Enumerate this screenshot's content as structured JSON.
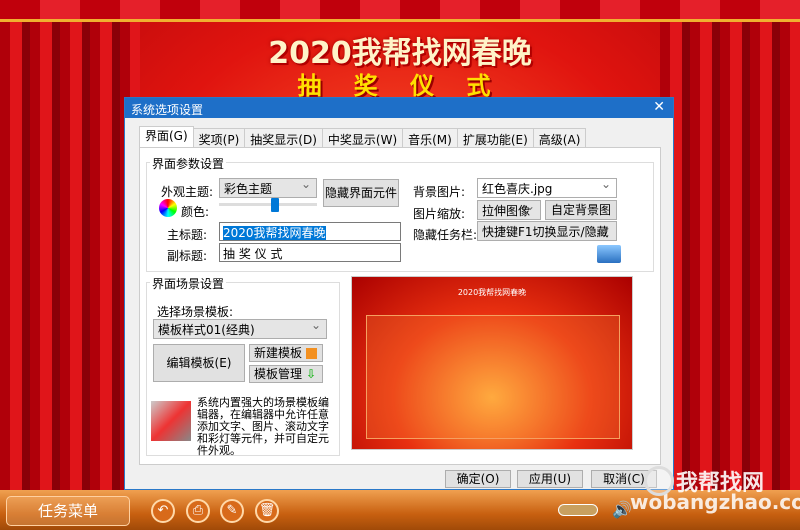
{
  "stage": {
    "title": "2020我帮找网春晚",
    "subtitle": "抽 奖 仪 式"
  },
  "dialog": {
    "title": "系统选项设置",
    "tabs": [
      "界面(G)",
      "奖项(P)",
      "抽奖显示(D)",
      "中奖显示(W)",
      "音乐(M)",
      "扩展功能(E)",
      "高级(A)"
    ],
    "params": {
      "group_label": "界面参数设置",
      "theme_label": "外观主题:",
      "theme_value": "彩色主题",
      "hide_ui_button": "隐藏界面元件",
      "color_label": "颜色:",
      "color_slider_position": 0.55,
      "main_title_label": "主标题:",
      "main_title_value": "2020我帮找网春晚",
      "subtitle_label": "副标题:",
      "subtitle_value": "抽 奖 仪 式",
      "bg_label": "背景图片:",
      "bg_value": "红色喜庆.jpg",
      "scale_label": "图片缩放:",
      "scale_value": "拉伸图像",
      "custom_bg_button": "自定背景图片",
      "taskbar_label": "隐藏任务栏:",
      "taskbar_value": "快捷键F1切换显示/隐藏"
    },
    "scene": {
      "group_label": "界面场景设置",
      "template_label": "选择场景模板:",
      "template_value": "模板样式01(经典)",
      "edit_button": "编辑模板(E)",
      "new_button": "新建模板",
      "manage_button": "模板管理",
      "description": "系统内置强大的场景模板编辑器，在编辑器中允许任意添加文字、图片、滚动文字和彩灯等元件，并可自定元件外观。",
      "preview_title": "2020我帮找网春晚"
    },
    "buttons": {
      "ok": "确定(O)",
      "apply": "应用(U)",
      "cancel": "取消(C)"
    }
  },
  "taskbar": {
    "menu": "任务菜单",
    "watermark": "我帮找网",
    "watermark_url": "wobangzhao.com"
  }
}
